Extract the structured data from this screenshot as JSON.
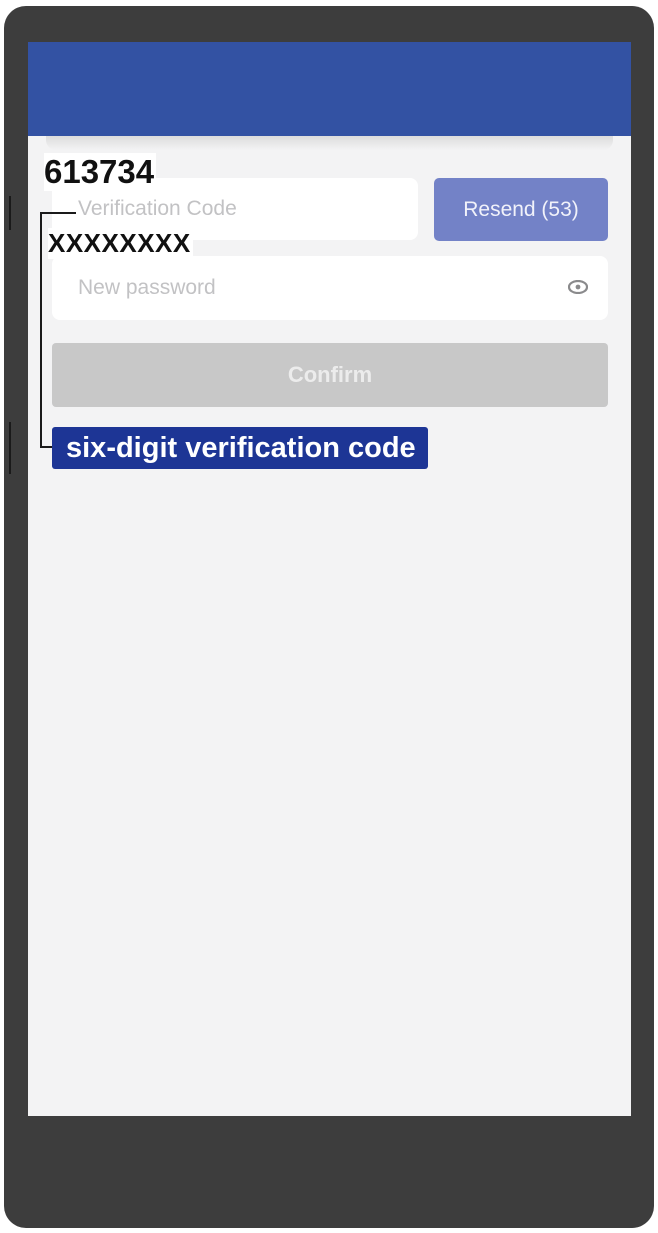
{
  "code_field": {
    "placeholder": "Verification Code",
    "value": "613734"
  },
  "resend_button": {
    "label": "Resend (53)"
  },
  "password_field": {
    "placeholder": "New password",
    "value": "XXXXXXXX"
  },
  "confirm_button": {
    "label": "Confirm"
  },
  "annotation": {
    "label": "six-digit verification code"
  },
  "colors": {
    "header": "#3352a3",
    "resend": "#7382c7",
    "confirm_disabled": "#c8c8c8",
    "annotation_badge": "#1d3595"
  }
}
